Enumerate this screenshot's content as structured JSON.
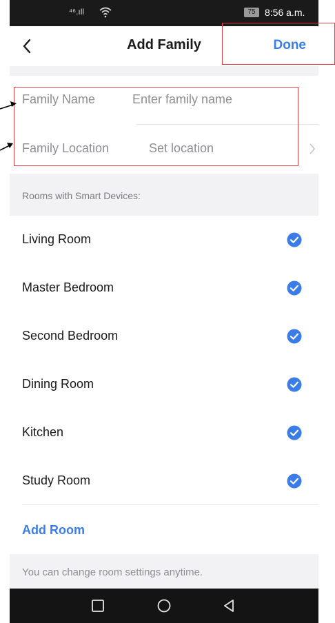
{
  "status_bar": {
    "signal": "⁴⁶.ıll",
    "battery": "75",
    "time": "8:56 a.m."
  },
  "header": {
    "title": "Add Family",
    "done_label": "Done"
  },
  "form": {
    "family_name": {
      "label": "Family Name",
      "placeholder": "Enter family name"
    },
    "family_location": {
      "label": "Family Location",
      "placeholder": "Set location"
    }
  },
  "rooms_section": {
    "label": "Rooms with Smart Devices:",
    "rooms": [
      {
        "name": "Living Room",
        "checked": true
      },
      {
        "name": "Master Bedroom",
        "checked": true
      },
      {
        "name": "Second Bedroom",
        "checked": true
      },
      {
        "name": "Dining Room",
        "checked": true
      },
      {
        "name": "Kitchen",
        "checked": true
      },
      {
        "name": "Study Room",
        "checked": true
      }
    ],
    "add_room_label": "Add Room"
  },
  "footer": {
    "note": "You can change room settings anytime."
  },
  "icons": {
    "back": "chevron-left-icon",
    "check": "check-circle-icon",
    "location_chevron": "chevron-right-icon",
    "nav_recent": "square-icon",
    "nav_home": "circle-icon",
    "nav_back": "triangle-back-icon"
  },
  "colors": {
    "accent": "#3a7de8",
    "annotation": "#e0414b",
    "section_bg": "#f2f2f4"
  }
}
